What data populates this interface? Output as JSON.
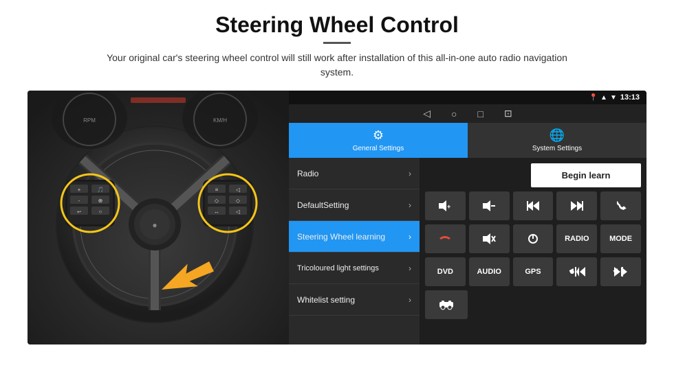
{
  "header": {
    "title": "Steering Wheel Control",
    "subtitle": "Your original car's steering wheel control will still work after installation of this all-in-one auto radio navigation system.",
    "divider": true
  },
  "statusBar": {
    "time": "13:13",
    "icons": [
      "location-pin",
      "signal",
      "wifi"
    ]
  },
  "navBar": {
    "items": [
      "◁",
      "○",
      "□",
      "⊡"
    ]
  },
  "tabs": [
    {
      "id": "general",
      "label": "General Settings",
      "icon": "⚙",
      "active": true
    },
    {
      "id": "system",
      "label": "System Settings",
      "icon": "🌐",
      "active": false
    }
  ],
  "menuItems": [
    {
      "id": "radio",
      "label": "Radio",
      "active": false
    },
    {
      "id": "default",
      "label": "DefaultSetting",
      "active": false
    },
    {
      "id": "steering",
      "label": "Steering Wheel learning",
      "active": true
    },
    {
      "id": "tricoloured",
      "label": "Tricoloured light settings",
      "active": false
    },
    {
      "id": "whitelist",
      "label": "Whitelist setting",
      "active": false
    }
  ],
  "controlPanel": {
    "beginLearnLabel": "Begin learn",
    "row1": [
      {
        "id": "vol-up",
        "label": "🔊+",
        "unicode": "🔊+"
      },
      {
        "id": "vol-down",
        "label": "🔇-",
        "unicode": "🔇-"
      },
      {
        "id": "prev-track",
        "label": "⏮",
        "unicode": "⏮"
      },
      {
        "id": "next-track",
        "label": "⏭",
        "unicode": "⏭"
      },
      {
        "id": "phone",
        "label": "📞",
        "unicode": "📞"
      }
    ],
    "row2": [
      {
        "id": "hang-up",
        "label": "📵",
        "unicode": "📵"
      },
      {
        "id": "mute",
        "label": "🔇×",
        "unicode": "🔇×"
      },
      {
        "id": "power",
        "label": "⏻",
        "unicode": "⏻"
      },
      {
        "id": "radio-btn",
        "label": "RADIO",
        "unicode": "RADIO"
      },
      {
        "id": "mode-btn",
        "label": "MODE",
        "unicode": "MODE"
      }
    ],
    "row3": [
      {
        "id": "dvd",
        "label": "DVD",
        "unicode": "DVD"
      },
      {
        "id": "audio",
        "label": "AUDIO",
        "unicode": "AUDIO"
      },
      {
        "id": "gps",
        "label": "GPS",
        "unicode": "GPS"
      },
      {
        "id": "phone-prev",
        "label": "📞⏮",
        "unicode": "📞⏮"
      },
      {
        "id": "phone-next",
        "label": "📞⏭",
        "unicode": "📞⏭"
      }
    ],
    "row4": [
      {
        "id": "extra",
        "label": "🚗",
        "unicode": "🚗"
      }
    ]
  }
}
